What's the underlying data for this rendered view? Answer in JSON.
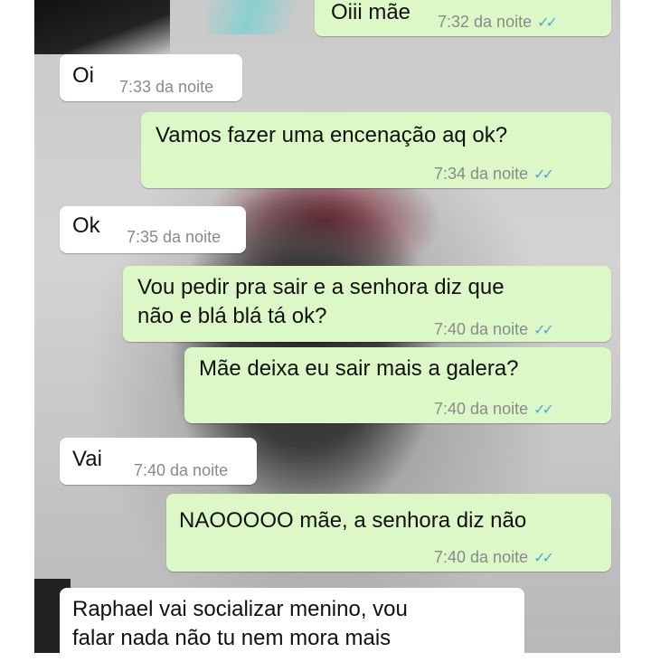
{
  "messages": [
    {
      "side": "out",
      "text": "Oiii mãe",
      "time": "7:32 da noite",
      "ticks": "✓✓"
    },
    {
      "side": "in",
      "text": "Oi",
      "time": "7:33 da noite"
    },
    {
      "side": "out",
      "text": "Vamos fazer uma encenação aq ok?",
      "time": "7:34 da noite",
      "ticks": "✓✓"
    },
    {
      "side": "in",
      "text": "Ok",
      "time": "7:35 da noite"
    },
    {
      "side": "out",
      "text": "Vou pedir pra sair e a senhora diz que\nnão e blá blá tá ok?",
      "time": "7:40 da noite",
      "ticks": "✓✓"
    },
    {
      "side": "out",
      "text": "Mãe deixa eu sair mais a galera?",
      "time": "7:40 da noite",
      "ticks": "✓✓"
    },
    {
      "side": "in",
      "text": "Vai",
      "time": "7:40 da noite"
    },
    {
      "side": "out",
      "text": "NAOOOOO mãe, a senhora diz não",
      "time": "7:40 da noite",
      "ticks": "✓✓"
    },
    {
      "side": "in",
      "text": "Raphael vai socializar menino, vou\nfalar nada não tu nem mora mais"
    }
  ],
  "colors": {
    "outgoing_bubble": "#dcf8c6",
    "incoming_bubble": "#ffffff",
    "read_ticks": "#4fa6e0",
    "timestamp": "#8a8a8a"
  }
}
